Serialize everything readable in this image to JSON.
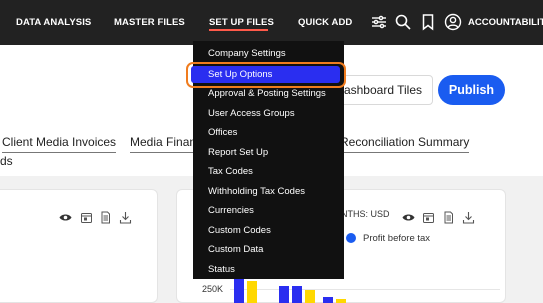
{
  "nav": {
    "items": [
      "DATA ANALYSIS",
      "MASTER FILES",
      "SET UP FILES",
      "QUICK ADD"
    ],
    "active_index": 2,
    "account_label": "ACCOUNTABILITY",
    "icons": [
      "sliders-icon",
      "search-icon",
      "bookmark-icon",
      "user-icon"
    ]
  },
  "toolbar": {
    "tiles_label": "Dashboard Tiles",
    "publish_label": "Publish"
  },
  "tabs": {
    "items": [
      "Client Media Invoices",
      "Media Finance",
      "Reconciliation Summary"
    ],
    "second_row_fragment": "ds"
  },
  "dropdown": {
    "items": [
      "Company Settings",
      "Set Up Options",
      "Approval & Posting Settings",
      "User Access Groups",
      "Offices",
      "Report Set Up",
      "Tax Codes",
      "Withholding Tax Codes",
      "Currencies",
      "Custom Codes",
      "Custom Data",
      "Status"
    ],
    "highlighted_index": 1
  },
  "chart": {
    "months_label": "NTHS: USD",
    "legend_label": "Profit before tax",
    "y_tick": "250K"
  },
  "colors": {
    "nav_bg": "#222222",
    "accent_red": "#ff5a4a",
    "menu_bg": "#111111",
    "highlight_blue": "#2a2ef0",
    "highlight_border": "#f07c1e",
    "primary_blue": "#1a5cf0",
    "bar_yellow": "#ffd800"
  }
}
